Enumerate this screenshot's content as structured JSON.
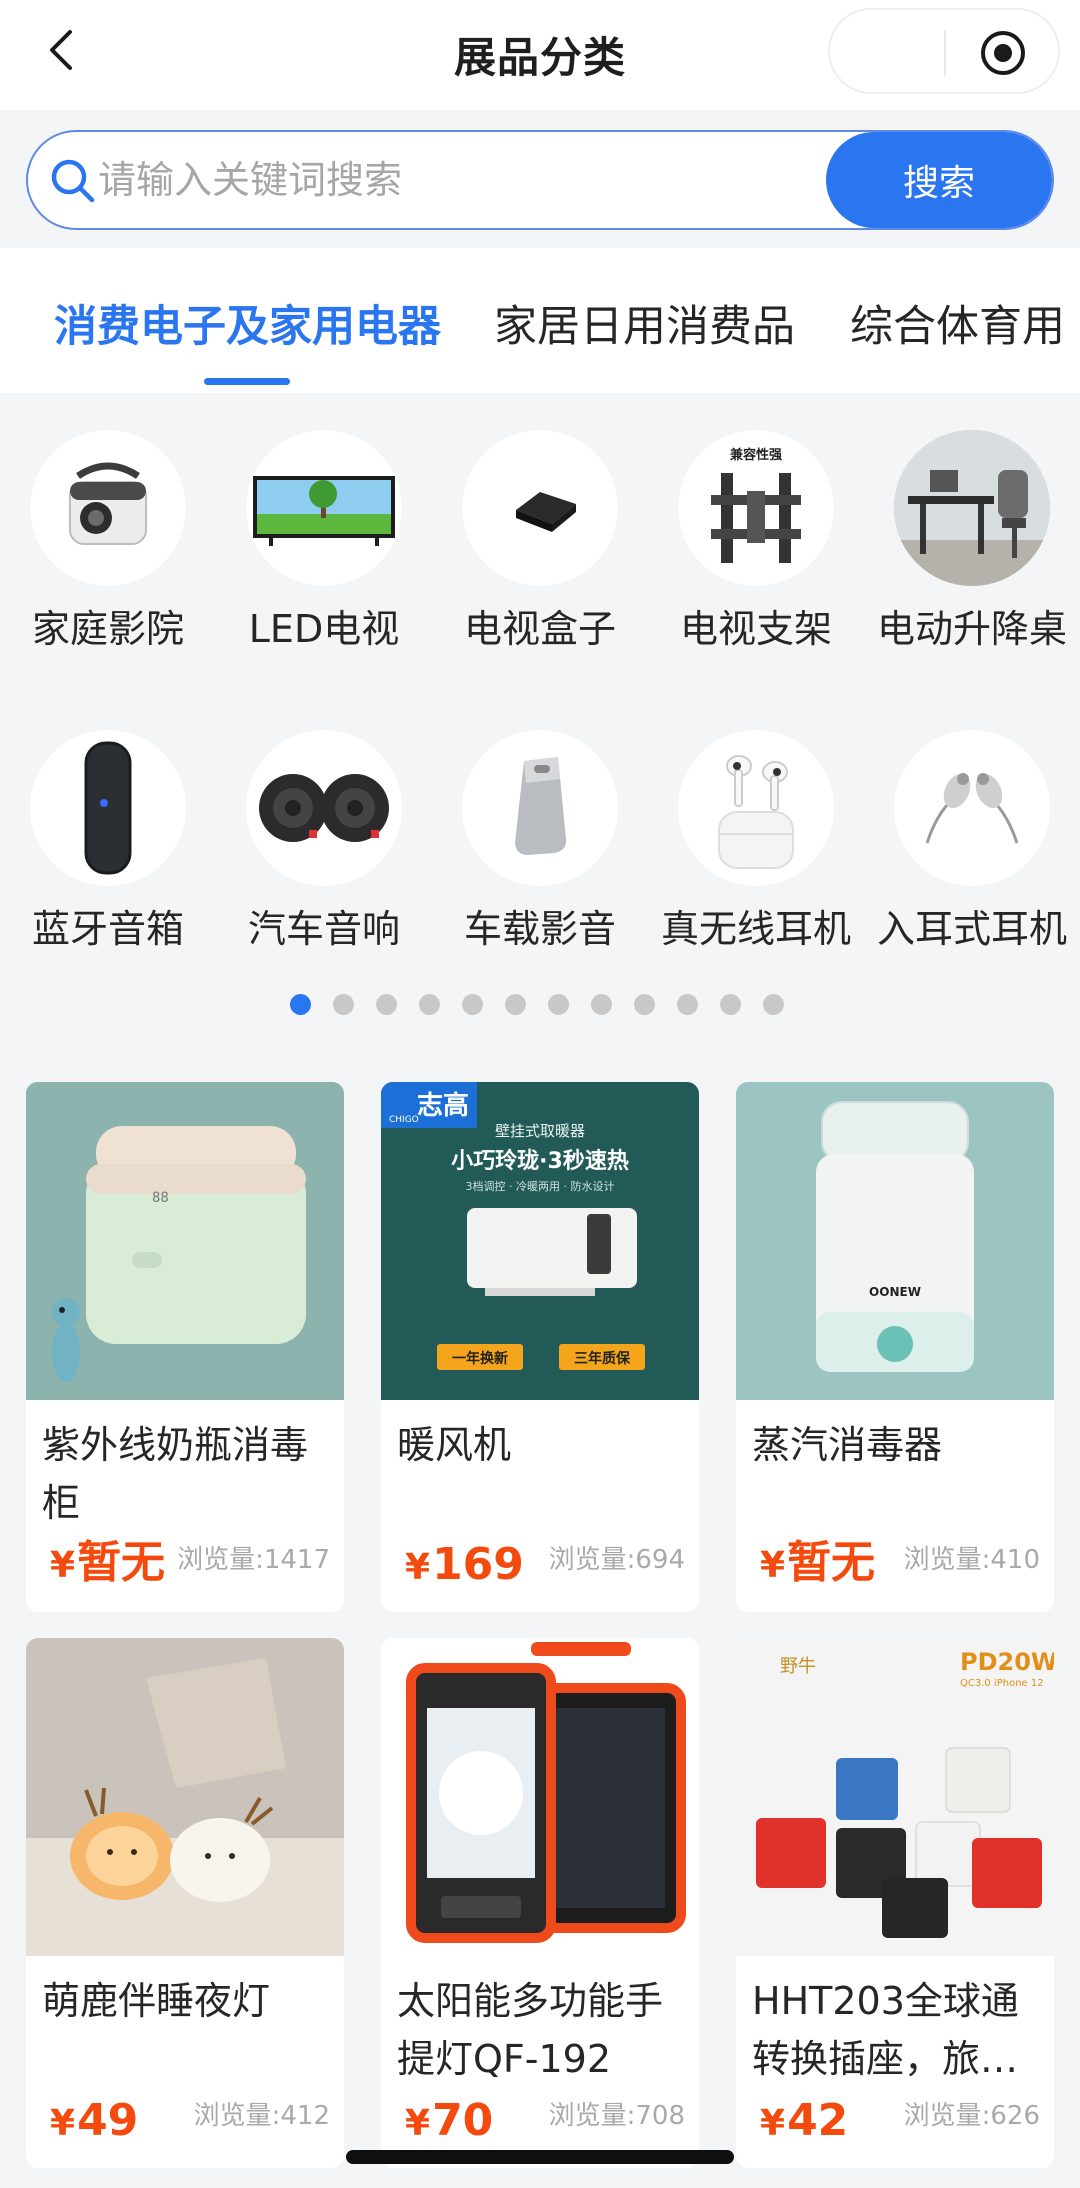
{
  "header": {
    "title": "展品分类",
    "back_icon": "chevron-left-icon",
    "capsule_icon": "target-icon"
  },
  "search": {
    "placeholder": "请输入关键词搜索",
    "value": "",
    "button_label": "搜索",
    "accent": "#2a75f0"
  },
  "tabs": [
    {
      "label": "消费电子及家用电器",
      "active": true
    },
    {
      "label": "家居日用消费品",
      "active": false
    },
    {
      "label": "综合体育用",
      "active": false
    }
  ],
  "categories": [
    {
      "label": "家庭影院",
      "icon": "projector-icon"
    },
    {
      "label": "LED电视",
      "icon": "tv-icon"
    },
    {
      "label": "电视盒子",
      "icon": "tv-box-icon"
    },
    {
      "label": "电视支架",
      "icon": "tv-mount-icon",
      "badge": "兼容性强"
    },
    {
      "label": "电动升降桌",
      "icon": "standing-desk-icon"
    },
    {
      "label": "蓝牙音箱",
      "icon": "bluetooth-speaker-icon"
    },
    {
      "label": "汽车音响",
      "icon": "car-speaker-icon"
    },
    {
      "label": "车载影音",
      "icon": "usb-drive-icon"
    },
    {
      "label": "真无线耳机",
      "icon": "wireless-earbuds-icon"
    },
    {
      "label": "入耳式耳机",
      "icon": "in-ear-earphones-icon"
    }
  ],
  "pagination": {
    "total": 12,
    "active": 0
  },
  "products": [
    {
      "title": "紫外线奶瓶消毒柜",
      "price": "暂无",
      "views": "浏览量:1417",
      "image": "sterilizer-cabinet-image"
    },
    {
      "title": "暖风机",
      "price": "169",
      "views": "浏览量:694",
      "image": "wall-heater-image",
      "image_text": {
        "brand": "志高",
        "brand_en": "CHIGO",
        "subtitle": "壁挂式取暖器",
        "headline": "小巧玲珑·3秒速热",
        "features": "3档调控 · 冷暖两用 · 防水设计",
        "tag1": "一年换新",
        "tag2": "三年质保"
      }
    },
    {
      "title": "蒸汽消毒器",
      "price": "暂无",
      "views": "浏览量:410",
      "image": "steam-sterilizer-image",
      "image_text": {
        "brand": "OONEW"
      }
    },
    {
      "title": "萌鹿伴睡夜灯",
      "price": "49",
      "views": "浏览量:412",
      "image": "deer-night-light-image"
    },
    {
      "title": "太阳能多功能手提灯QF-192",
      "price": "70",
      "views": "浏览量:708",
      "image": "solar-lantern-image"
    },
    {
      "title": "HHT203全球通转换插座，旅…",
      "price": "42",
      "views": "浏览量:626",
      "image": "travel-adapter-image",
      "image_text": {
        "brand": "野牛",
        "badge": "PD20W",
        "badge_sub": "QC3.0 iPhone 12"
      }
    }
  ],
  "currency_symbol": "¥",
  "colors": {
    "accent": "#2a75f0",
    "price": "#f44a0e",
    "background": "#f4f5f7"
  }
}
